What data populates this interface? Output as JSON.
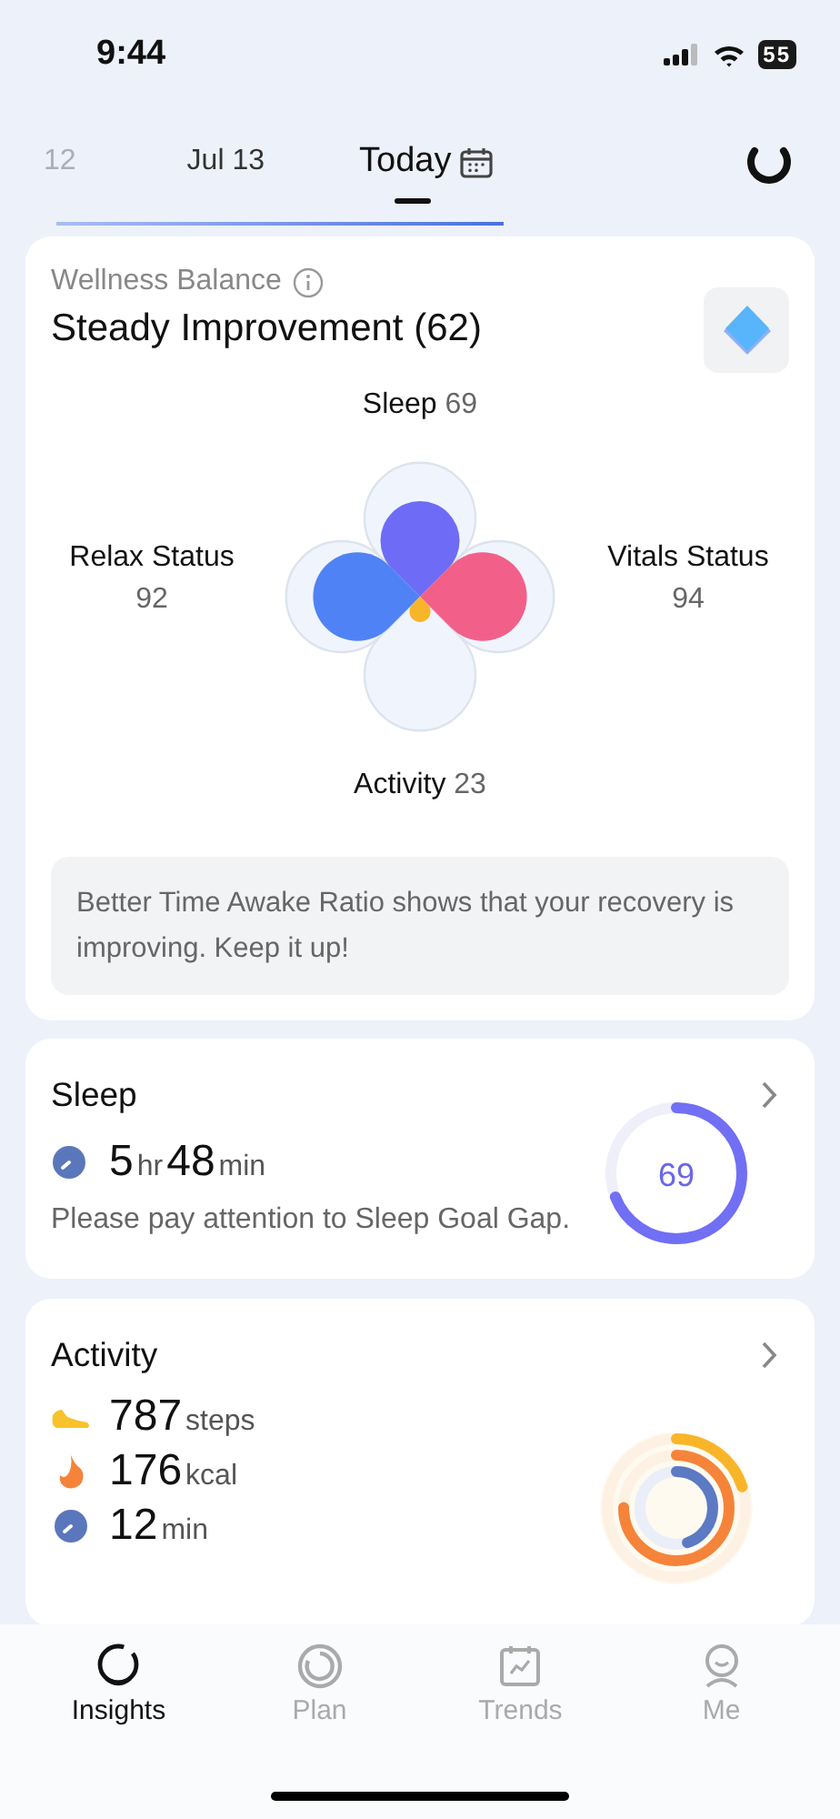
{
  "status_bar": {
    "time": "9:44",
    "battery": "55"
  },
  "dates": [
    {
      "label": "12",
      "selected": false
    },
    {
      "label": "Jul 13",
      "selected": false
    },
    {
      "label": "Today",
      "selected": true
    }
  ],
  "wellness": {
    "label": "Wellness Balance",
    "title": "Steady Improvement (62)",
    "petals": [
      {
        "name": "Sleep",
        "value": "69"
      },
      {
        "name": "Relax Status",
        "value": "92"
      },
      {
        "name": "Vitals Status",
        "value": "94"
      },
      {
        "name": "Activity",
        "value": "23"
      }
    ],
    "tip": "Better Time Awake Ratio shows that your recovery is improving. Keep it up!"
  },
  "sleep": {
    "title": "Sleep",
    "hours": "5",
    "hours_unit": "hr",
    "minutes": "48",
    "minutes_unit": "min",
    "note": "Please pay attention to Sleep Goal Gap.",
    "score": "69",
    "level": 0.69
  },
  "activity": {
    "title": "Activity",
    "metrics": [
      {
        "kind": "steps",
        "value": "787",
        "unit": "steps"
      },
      {
        "kind": "calories",
        "value": "176",
        "unit": "kcal"
      },
      {
        "kind": "duration",
        "value": "12",
        "unit": "min"
      }
    ],
    "rings": [
      {
        "level": 0.2,
        "color": "#f9b52a"
      },
      {
        "level": 0.75,
        "color": "#f5843a"
      },
      {
        "level": 0.45,
        "color": "#5c79c4"
      }
    ]
  },
  "tabs": [
    {
      "label": "Insights",
      "selected": true
    },
    {
      "label": "Plan",
      "selected": false
    },
    {
      "label": "Trends",
      "selected": false
    },
    {
      "label": "Me",
      "selected": false
    }
  ]
}
